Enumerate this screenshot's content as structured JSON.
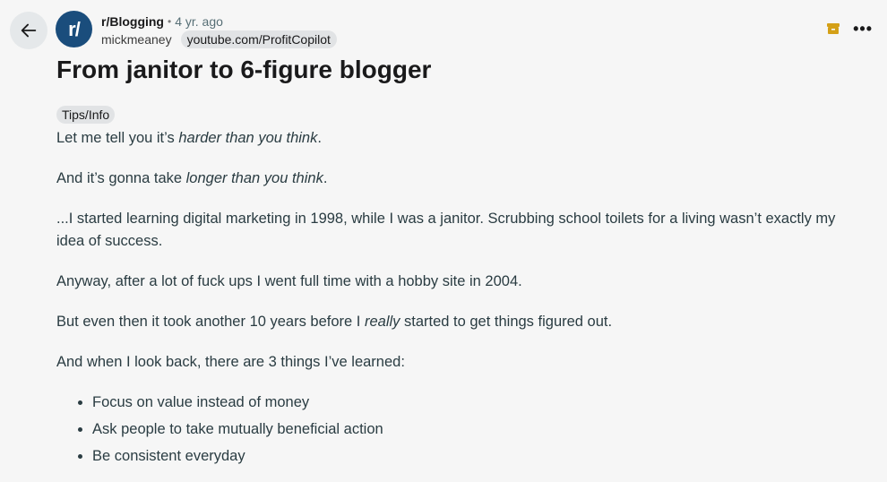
{
  "nav": {
    "back_icon": "arrow-left-icon"
  },
  "post": {
    "avatar_text": "r/",
    "subreddit": "r/Blogging",
    "separator": "•",
    "age": "4 yr. ago",
    "author": "mickmeaney",
    "user_flair": "youtube.com/ProfitCopilot",
    "title": "From janitor to 6-figure blogger",
    "post_flair": "Tips/Info",
    "actions": {
      "archive_icon": "archive-icon",
      "more_icon": "more-options-icon",
      "archive_color": "#d4a017"
    }
  },
  "body": {
    "p1": {
      "pre": "Let me tell you it’s ",
      "em": "harder than you think",
      "post": "."
    },
    "p2": {
      "pre": "And it’s gonna take ",
      "em": "longer than you think",
      "post": "."
    },
    "p3": "...I started learning digital marketing in 1998, while I was a janitor. Scrubbing school toilets for a living wasn’t exactly my idea of success.",
    "p4": "Anyway, after a lot of fuck ups I went full time with a hobby site in 2004.",
    "p5": {
      "pre": "But even then it took another 10 years before I ",
      "em": "really",
      "post": " started to get things figured out."
    },
    "p6": "And when I look back, there are 3 things I’ve learned:",
    "list": [
      "Focus on value instead of money",
      "Ask people to take mutually beneficial action",
      "Be consistent everyday"
    ]
  }
}
